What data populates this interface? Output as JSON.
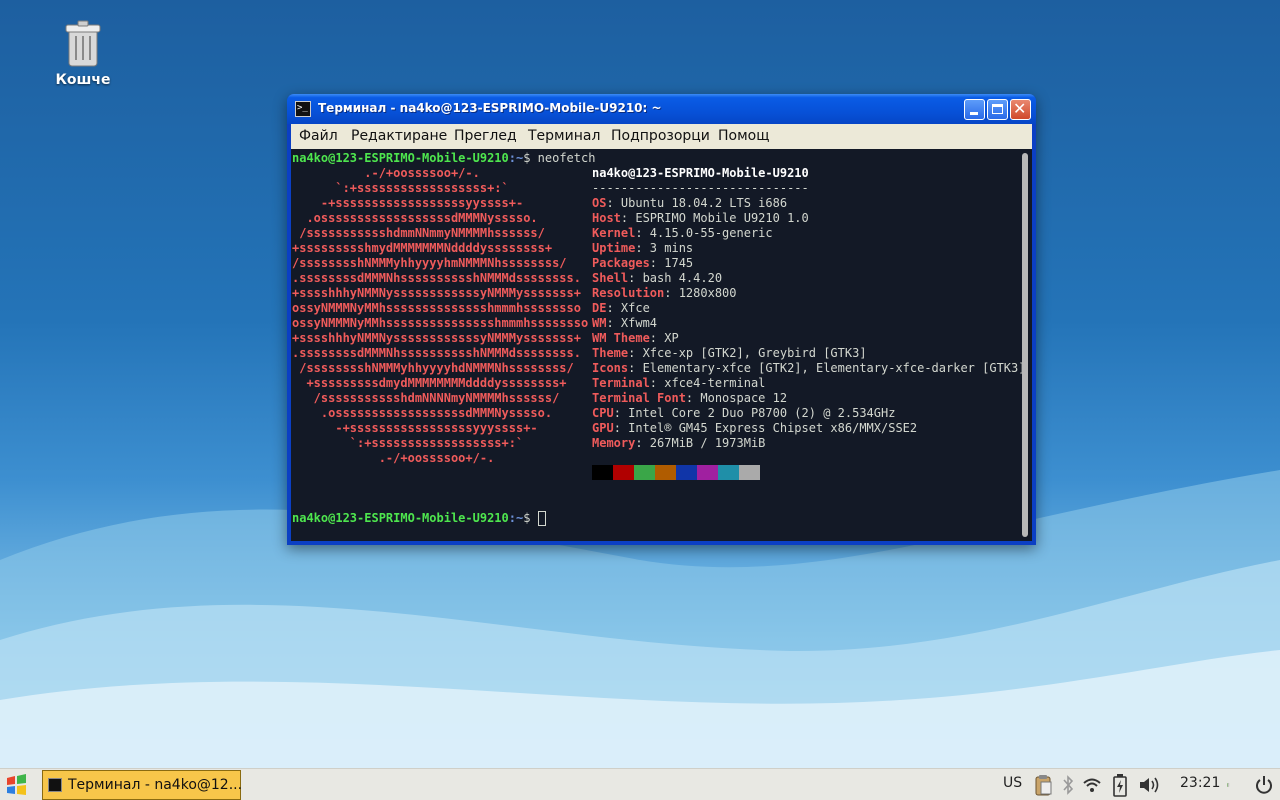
{
  "desktop": {
    "trash_label": "Кошче"
  },
  "window": {
    "title": "Терминал - na4ko@123-ESPRIMO-Mobile-U9210: ~",
    "menu": [
      "Файл",
      "Редактиране",
      "Преглед",
      "Терминал",
      "Подпрозорци",
      "Помощ"
    ]
  },
  "terminal": {
    "prompt_user": "na4ko@123-ESPRIMO-Mobile-U9210",
    "prompt_path": ":~",
    "prompt_sym": "$ ",
    "command": "neofetch",
    "logo": [
      "          .-/+oossssoo+/-.",
      "      `:+ssssssssssssssssss+:`",
      "    -+ssssssssssssssssssyyssss+-",
      "  .ossssssssssssssssssdMMMNysssso.",
      " /ssssssssssshdmmNNmmyNMMMMhssssss/",
      "+ssssssssshmydMMMMMMMNddddyssssssss+",
      "/sssssssshNMMMyhhyyyyhmNMMMNhssssssss/",
      ".ssssssssdMMMNhsssssssssshNMMMdssssssss.",
      "+sssshhhyNMMNyssssssssssssyNMMMysssssss+",
      "ossyNMMMNyMMhsssssssssssssshmmmhssssssso",
      "ossyNMMMNyMMhssssssssssssssshmmmhssssssso",
      "+sssshhhyNMMNyssssssssssssyNMMMysssssss+",
      ".ssssssssdMMMNhsssssssssshNMMMdssssssss.",
      " /sssssssshNMMMyhhyyyyhdNMMMNhssssssss/",
      "  +sssssssssdmydMMMMMMMMddddyssssssss+",
      "   /ssssssssssshdmNNNNmyNMMMMhssssss/",
      "    .ossssssssssssssssssdMMMNysssso.",
      "      -+sssssssssssssssssyyyssss+-",
      "        `:+ssssssssssssssssss+:`",
      "            .-/+oossssoo+/-."
    ],
    "header": "na4ko@123-ESPRIMO-Mobile-U9210",
    "divider": "------------------------------",
    "info": [
      {
        "label": "OS",
        "value": ": Ubuntu 18.04.2 LTS i686"
      },
      {
        "label": "Host",
        "value": ": ESPRIMO Mobile U9210 1.0"
      },
      {
        "label": "Kernel",
        "value": ": 4.15.0-55-generic"
      },
      {
        "label": "Uptime",
        "value": ": 3 mins"
      },
      {
        "label": "Packages",
        "value": ": 1745"
      },
      {
        "label": "Shell",
        "value": ": bash 4.4.20"
      },
      {
        "label": "Resolution",
        "value": ": 1280x800"
      },
      {
        "label": "DE",
        "value": ": Xfce"
      },
      {
        "label": "WM",
        "value": ": Xfwm4"
      },
      {
        "label": "WM Theme",
        "value": ": XP"
      },
      {
        "label": "Theme",
        "value": ": Xfce-xp [GTK2], Greybird [GTK3]"
      },
      {
        "label": "Icons",
        "value": ": Elementary-xfce [GTK2], Elementary-xfce-darker [GTK3]"
      },
      {
        "label": "Terminal",
        "value": ": xfce4-terminal"
      },
      {
        "label": "Terminal Font",
        "value": ": Monospace 12"
      },
      {
        "label": "CPU",
        "value": ": Intel Core 2 Duo P8700 (2) @ 2.534GHz"
      },
      {
        "label": "GPU",
        "value": ": Intel® GM45 Express Chipset x86/MMX/SSE2"
      },
      {
        "label": "Memory",
        "value": ": 267MiB / 1973MiB"
      }
    ],
    "palette": [
      "#000000",
      "#b00000",
      "#3aa648",
      "#b05c00",
      "#1035a8",
      "#a020a0",
      "#1f8fa8",
      "#aaaaaa"
    ]
  },
  "taskbar": {
    "task_label": "Терминал - na4ko@12...",
    "keyboard_layout": "US",
    "clock": "23:21"
  }
}
